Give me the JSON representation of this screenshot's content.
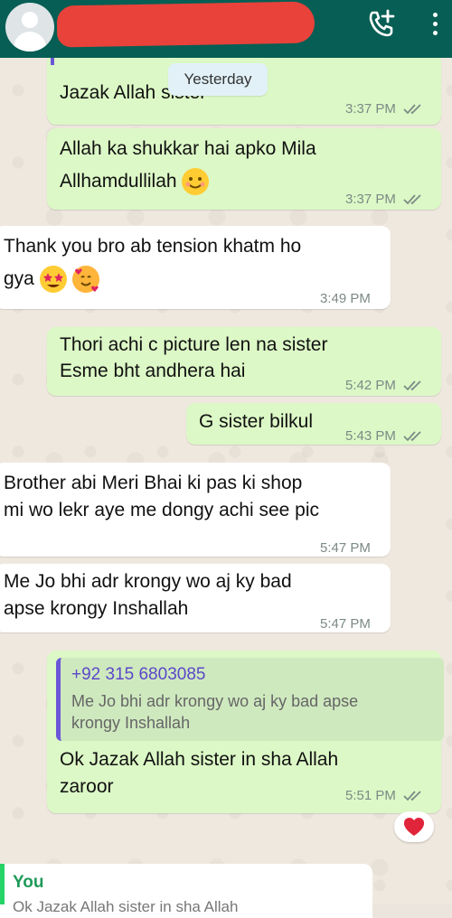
{
  "header": {
    "contact_name": "",
    "call_icon": "add-call-icon",
    "menu_icon": "more-vertical-icon"
  },
  "date_divider": "Yesterday",
  "messages": [
    {
      "dir": "out",
      "text": "Jazak Allah sister",
      "time": "3:37 PM",
      "status": "read"
    },
    {
      "dir": "out",
      "line1": "Allah ka shukkar hai apko Mila",
      "line2": "Allhamdullilah",
      "time": "3:37 PM",
      "status": "read"
    },
    {
      "dir": "in",
      "line1": "Thank you bro ab tension khatm ho",
      "line2": "gya",
      "time": "3:49 PM"
    },
    {
      "dir": "out",
      "line1": "Thori achi c picture len na sister",
      "line2": "Esme bht andhera hai",
      "time": "5:42 PM",
      "status": "read"
    },
    {
      "dir": "out",
      "text": "G sister bilkul",
      "time": "5:43 PM",
      "status": "read"
    },
    {
      "dir": "in",
      "line1": "Brother abi Meri Bhai ki pas ki shop",
      "line2": "mi wo lekr aye me dongy achi see pic",
      "time": "5:47 PM"
    },
    {
      "dir": "in",
      "line1": "Me Jo bhi adr krongy wo aj ky bad",
      "line2": "apse krongy Inshallah",
      "time": "5:47 PM"
    },
    {
      "dir": "out",
      "quote_sender": "+92 315 6803085",
      "quote_line1": "Me Jo bhi adr krongy wo aj ky bad apse",
      "quote_line2": "krongy Inshallah",
      "line1": "Ok Jazak Allah sister in sha Allah",
      "line2": "zaroor",
      "time": "5:51 PM",
      "status": "read",
      "reaction": "heart"
    }
  ],
  "reply_preview": {
    "sender": "You",
    "snippet": "Ok Jazak Allah sister in sha Allah"
  },
  "colors": {
    "header": "#075e54",
    "outgoing_bubble": "#dcf8c6",
    "incoming_bubble": "#ffffff",
    "quote_accent": "#6b57d8",
    "read_ticks": "#7c8a86"
  }
}
